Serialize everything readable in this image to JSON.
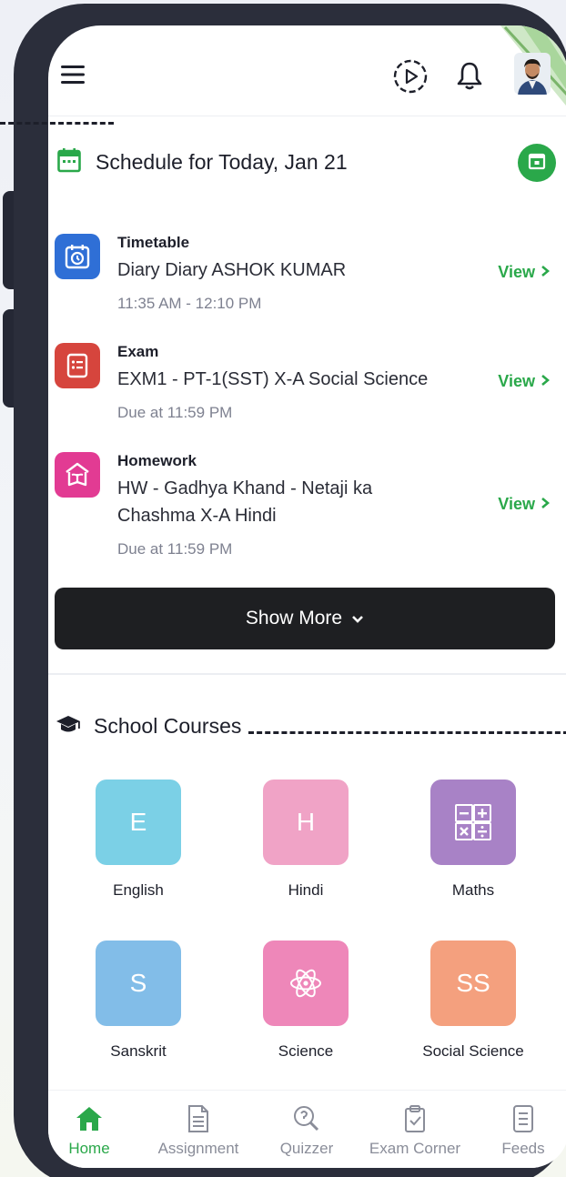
{
  "header": {
    "menu_icon": "hamburger-menu-icon",
    "play_icon": "play-circle-icon",
    "bell_icon": "bell-icon",
    "avatar": "user-avatar"
  },
  "schedule": {
    "title": "Schedule for Today, Jan 21",
    "items": [
      {
        "type": "Timetable",
        "description": "Diary  Diary  ASHOK KUMAR",
        "time": "11:35 AM - 12:10 PM",
        "action": "View",
        "icon": "calendar-clock-icon",
        "color": "#2f6fd6"
      },
      {
        "type": "Exam",
        "description": "EXM1 - PT-1(SST) X-A Social Science",
        "time": "Due at 11:59 PM",
        "action": "View",
        "icon": "exam-list-icon",
        "color": "#d6453d"
      },
      {
        "type": "Homework",
        "description": "HW -  Gadhya Khand - Netaji ka Chashma X-A Hindi",
        "time": "Due at 11:59 PM",
        "action": "View",
        "icon": "book-house-icon",
        "color": "#e23b93"
      }
    ],
    "show_more": "Show More"
  },
  "courses": {
    "title": "School Courses",
    "items": [
      {
        "name": "English",
        "letter": "E",
        "color": "#7bd0e6"
      },
      {
        "name": "Hindi",
        "letter": "H",
        "color": "#f0a3c6"
      },
      {
        "name": "Maths",
        "letter": "",
        "color": "#a882c6"
      },
      {
        "name": "Sanskrit",
        "letter": "S",
        "color": "#82bde8"
      },
      {
        "name": "Science",
        "letter": "",
        "color": "#ee87b9"
      },
      {
        "name": "Social Science",
        "letter": "SS",
        "color": "#f4a07e"
      }
    ]
  },
  "nav": [
    {
      "label": "Home",
      "icon": "home-icon",
      "active": true
    },
    {
      "label": "Assignment",
      "icon": "document-icon",
      "active": false
    },
    {
      "label": "Quizzer",
      "icon": "quiz-icon",
      "active": false
    },
    {
      "label": "Exam Corner",
      "icon": "clipboard-check-icon",
      "active": false
    },
    {
      "label": "Feeds",
      "icon": "feeds-icon",
      "active": false
    }
  ],
  "colors": {
    "accent_green": "#2aa84a",
    "dark_button": "#1e1f22"
  }
}
